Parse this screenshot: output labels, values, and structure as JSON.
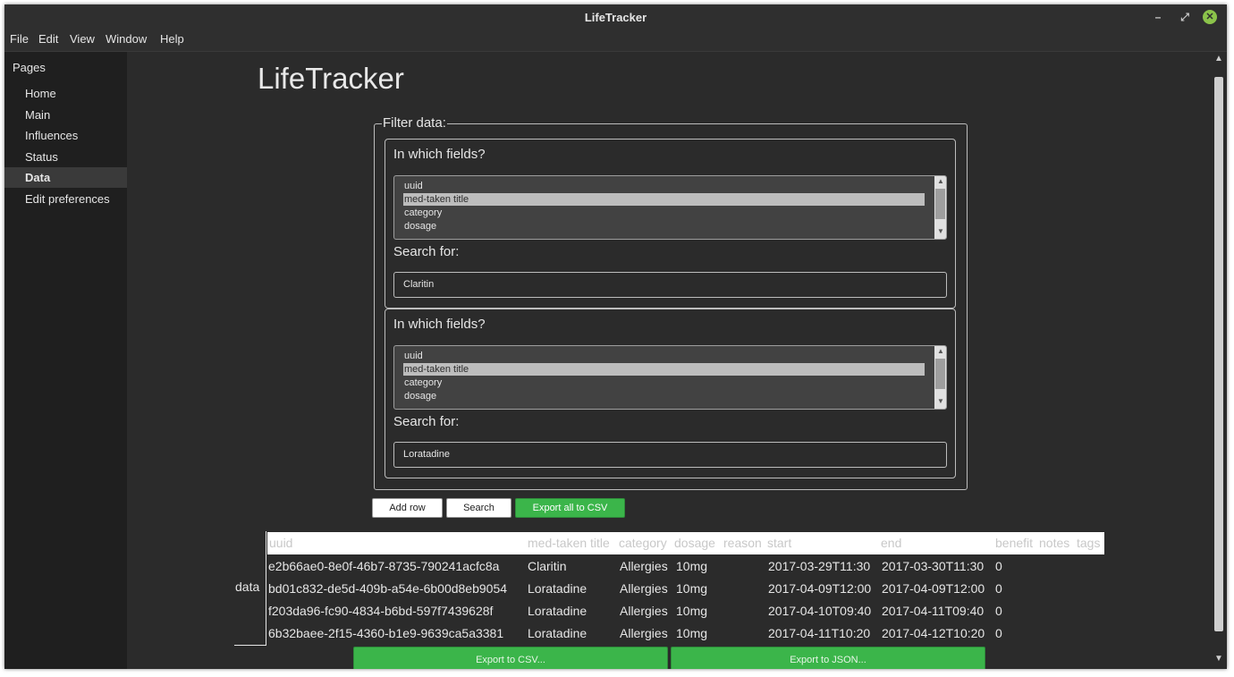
{
  "window": {
    "title": "LifeTracker"
  },
  "menu": [
    "File",
    "Edit",
    "View",
    "Window",
    "Help"
  ],
  "sidebar": {
    "section": "Pages",
    "items": [
      {
        "label": "Home",
        "active": false
      },
      {
        "label": "Main",
        "active": false
      },
      {
        "label": "Influences",
        "active": false
      },
      {
        "label": "Status",
        "active": false
      },
      {
        "label": "Data",
        "active": true
      },
      {
        "label": "Edit preferences",
        "active": false
      }
    ]
  },
  "main": {
    "title": "LifeTracker",
    "filter": {
      "legend": "Filter data:",
      "blocks": [
        {
          "fields_label": "In which fields?",
          "options": [
            "uuid",
            "med-taken title",
            "category",
            "dosage"
          ],
          "selected": "med-taken title",
          "search_label": "Search for:",
          "search_value": "Claritin"
        },
        {
          "fields_label": "In which fields?",
          "options": [
            "uuid",
            "med-taken title",
            "category",
            "dosage"
          ],
          "selected": "med-taken title",
          "search_label": "Search for:",
          "search_value": "Loratadine"
        }
      ]
    },
    "buttons": {
      "add_row": "Add row",
      "search": "Search",
      "export_all_csv": "Export all to CSV"
    },
    "table": {
      "name": "data",
      "headers": [
        "uuid",
        "med-taken title",
        "category",
        "dosage",
        "reason",
        "start",
        "end",
        "benefit",
        "notes",
        "tags"
      ],
      "rows": [
        [
          "e2b66ae0-8e0f-46b7-8735-790241acfc8a",
          "Claritin",
          "Allergies",
          "10mg",
          "",
          "2017-03-29T11:30",
          "2017-03-30T11:30",
          "0",
          "",
          ""
        ],
        [
          "bd01c832-de5d-409b-a54e-6b00d8eb9054",
          "Loratadine",
          "Allergies",
          "10mg",
          "",
          "2017-04-09T12:00",
          "2017-04-09T12:00",
          "0",
          "",
          ""
        ],
        [
          "f203da96-fc90-4834-b6bd-597f7439628f",
          "Loratadine",
          "Allergies",
          "10mg",
          "",
          "2017-04-10T09:40",
          "2017-04-11T09:40",
          "0",
          "",
          ""
        ],
        [
          "6b32baee-2f15-4360-b1e9-9639ca5a3381",
          "Loratadine",
          "Allergies",
          "10mg",
          "",
          "2017-04-11T10:20",
          "2017-04-12T10:20",
          "0",
          "",
          ""
        ]
      ]
    },
    "export": {
      "csv": "Export to CSV...",
      "json": "Export to JSON..."
    }
  },
  "colors": {
    "accent_green": "#3bb54a",
    "background": "#2b2b2b",
    "sidebar": "#1f1f1f"
  },
  "icons": {
    "minimize": "minimize-icon",
    "restore": "restore-icon",
    "close": "close-icon"
  }
}
